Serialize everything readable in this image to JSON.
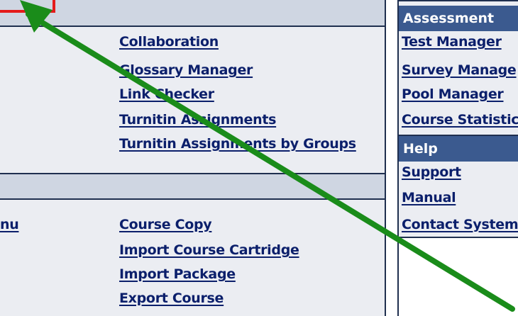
{
  "left_panel": {
    "links_col2": [
      "Collaboration",
      "Glossary Manager",
      "Link Checker",
      "Turnitin Assignments",
      "Turnitin Assignments by Groups"
    ],
    "links_col1_bottom": [
      "nu"
    ],
    "links_col2_bottom": [
      "Course Copy",
      "Import Course Cartridge",
      "Import Package",
      "Export Course"
    ]
  },
  "right_panel": {
    "assessment_header": "Assessment",
    "assessment_links": [
      "Test Manager",
      "Survey Manage",
      "Pool Manager",
      "Course Statistic"
    ],
    "help_header": "Help",
    "help_links": [
      "Support",
      "Manual",
      "Contact System"
    ]
  },
  "colors": {
    "header_bg": "#3b5a8f",
    "link": "#0b1f6b",
    "arrow": "#1a8c1a",
    "highlight": "#e41b1b"
  }
}
